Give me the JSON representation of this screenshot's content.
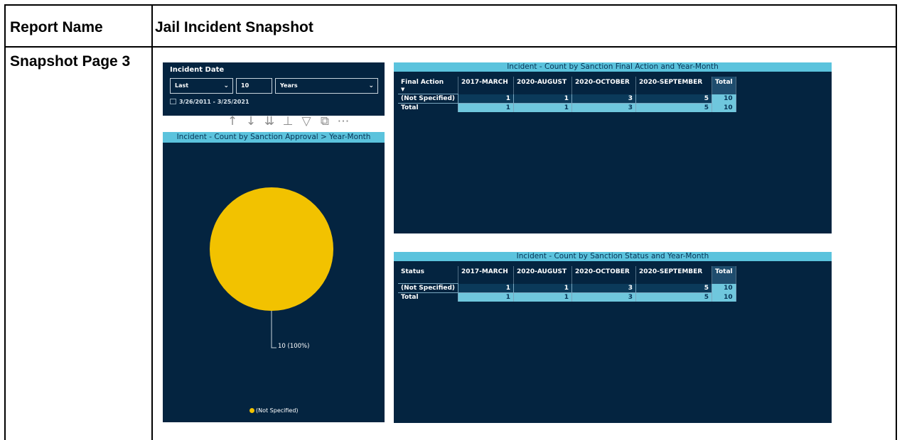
{
  "document": {
    "report_label": "Report Name",
    "report_value": "Jail Incident Snapshot",
    "snapshot_label": "Snapshot Page 3"
  },
  "slicer": {
    "title": "Incident Date",
    "mode": "Last",
    "count": "10",
    "unit": "Years",
    "range": "3/26/2011 - 3/25/2021"
  },
  "toolbar": [
    "up-arrow-icon",
    "down-arrow-icon",
    "double-down-arrow-icon",
    "expand-hierarchy-icon",
    "filter-icon",
    "focus-mode-icon",
    "more-options-icon"
  ],
  "pie": {
    "title": "Incident - Count by Sanction Approval > Year-Month",
    "data_label": "10 (100%)",
    "legend": "(Not Specified)",
    "color": "#f2c200",
    "chart_data": {
      "type": "pie",
      "categories": [
        "(Not Specified)"
      ],
      "values": [
        10
      ]
    }
  },
  "matrix1": {
    "title": "Incident - Count by Sanction Final Action and Year-Month",
    "row_header": "Final Action",
    "columns": [
      "2017-MARCH",
      "2020-AUGUST",
      "2020-OCTOBER",
      "2020-SEPTEMBER",
      "Total"
    ],
    "rows": [
      {
        "label": "(Not Specified)",
        "values": [
          "1",
          "1",
          "3",
          "5",
          "10"
        ]
      },
      {
        "label": "Total",
        "values": [
          "1",
          "1",
          "3",
          "5",
          "10"
        ]
      }
    ]
  },
  "matrix2": {
    "title": "Incident - Count by Sanction Status and Year-Month",
    "row_header": "Status",
    "columns": [
      "2017-MARCH",
      "2020-AUGUST",
      "2020-OCTOBER",
      "2020-SEPTEMBER",
      "Total"
    ],
    "rows": [
      {
        "label": "(Not Specified)",
        "values": [
          "1",
          "1",
          "3",
          "5",
          "10"
        ]
      },
      {
        "label": "Total",
        "values": [
          "1",
          "1",
          "3",
          "5",
          "10"
        ]
      }
    ]
  },
  "colors": {
    "panel_bg": "#042440",
    "caption_bg": "#5bc3dd",
    "total_cell": "#6fc7dd",
    "pie": "#f2c200"
  }
}
